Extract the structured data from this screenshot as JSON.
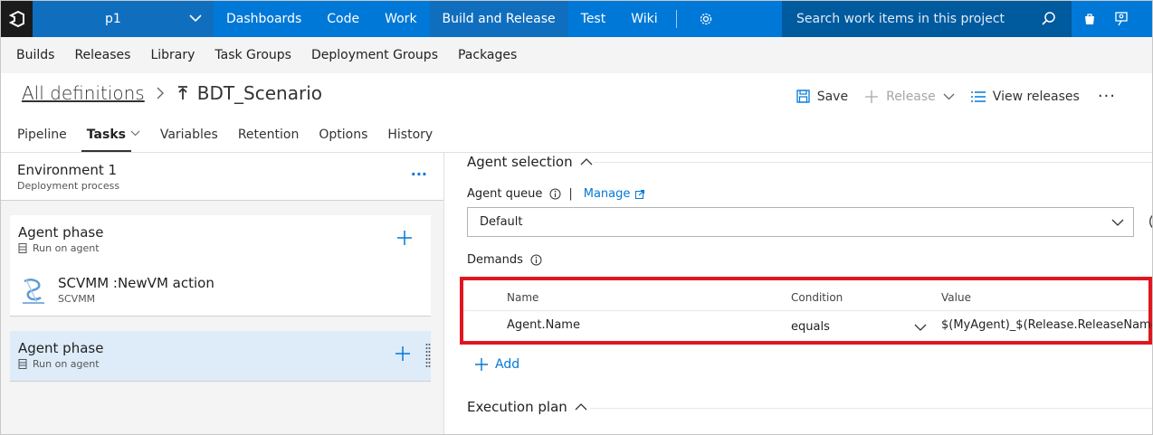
{
  "topnav": {
    "project": "p1",
    "items": [
      "Dashboards",
      "Code",
      "Work",
      "Build and Release",
      "Test",
      "Wiki"
    ],
    "active_item": "Build and Release",
    "search_placeholder": "Search work items in this project"
  },
  "subnav": {
    "items": [
      "Builds",
      "Releases",
      "Library",
      "Task Groups",
      "Deployment Groups",
      "Packages"
    ]
  },
  "header": {
    "breadcrumb_root": "All definitions",
    "title": "BDT_Scenario",
    "save_label": "Save",
    "release_label": "Release",
    "view_releases_label": "View releases"
  },
  "tabs": [
    "Pipeline",
    "Tasks",
    "Variables",
    "Retention",
    "Options",
    "History"
  ],
  "active_tab": "Tasks",
  "environment": {
    "title": "Environment 1",
    "subtitle": "Deployment process"
  },
  "phases": [
    {
      "title": "Agent phase",
      "subtitle": "Run on agent",
      "selected": false
    },
    {
      "title": "Agent phase",
      "subtitle": "Run on agent",
      "selected": true
    }
  ],
  "task": {
    "title": "SCVMM :NewVM action",
    "subtitle": "SCVMM"
  },
  "agent_selection": {
    "heading": "Agent selection",
    "queue_label": "Agent queue",
    "manage_label": "Manage",
    "queue_value": "Default",
    "demands_label": "Demands",
    "columns": [
      "Name",
      "Condition",
      "Value"
    ],
    "demand": {
      "name": "Agent.Name",
      "condition": "equals",
      "value": "$(MyAgent)_$(Release.ReleaseName)"
    },
    "add_label": "Add"
  },
  "execution_plan": {
    "heading": "Execution plan"
  },
  "colors": {
    "nav_blue": "#0078d7",
    "active_blue": "#106ebe",
    "search_blue": "#005a9e",
    "highlight_red": "#e0161f",
    "selected_phase": "#deecf9"
  }
}
